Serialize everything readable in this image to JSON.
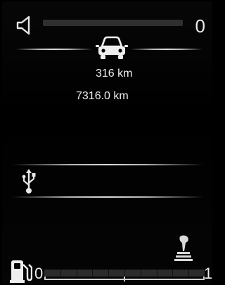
{
  "volume": {
    "value": "0",
    "level": 0.0,
    "icon": "speaker-icon"
  },
  "trip": {
    "icon": "car-icon",
    "distance": "316 km",
    "odometer": "7316.0 km"
  },
  "media": {
    "icon": "usb-icon"
  },
  "transmission": {
    "icon": "gear-shift-icon"
  },
  "fuel": {
    "icon": "fuel-pump-icon",
    "min_label": "0",
    "max_label": "1",
    "level": 0.0,
    "segments": 10
  },
  "colors": {
    "background": "#000000",
    "text": "#e6e6e6",
    "track": "#2f2f2f",
    "accent": "#d0d0d0"
  }
}
